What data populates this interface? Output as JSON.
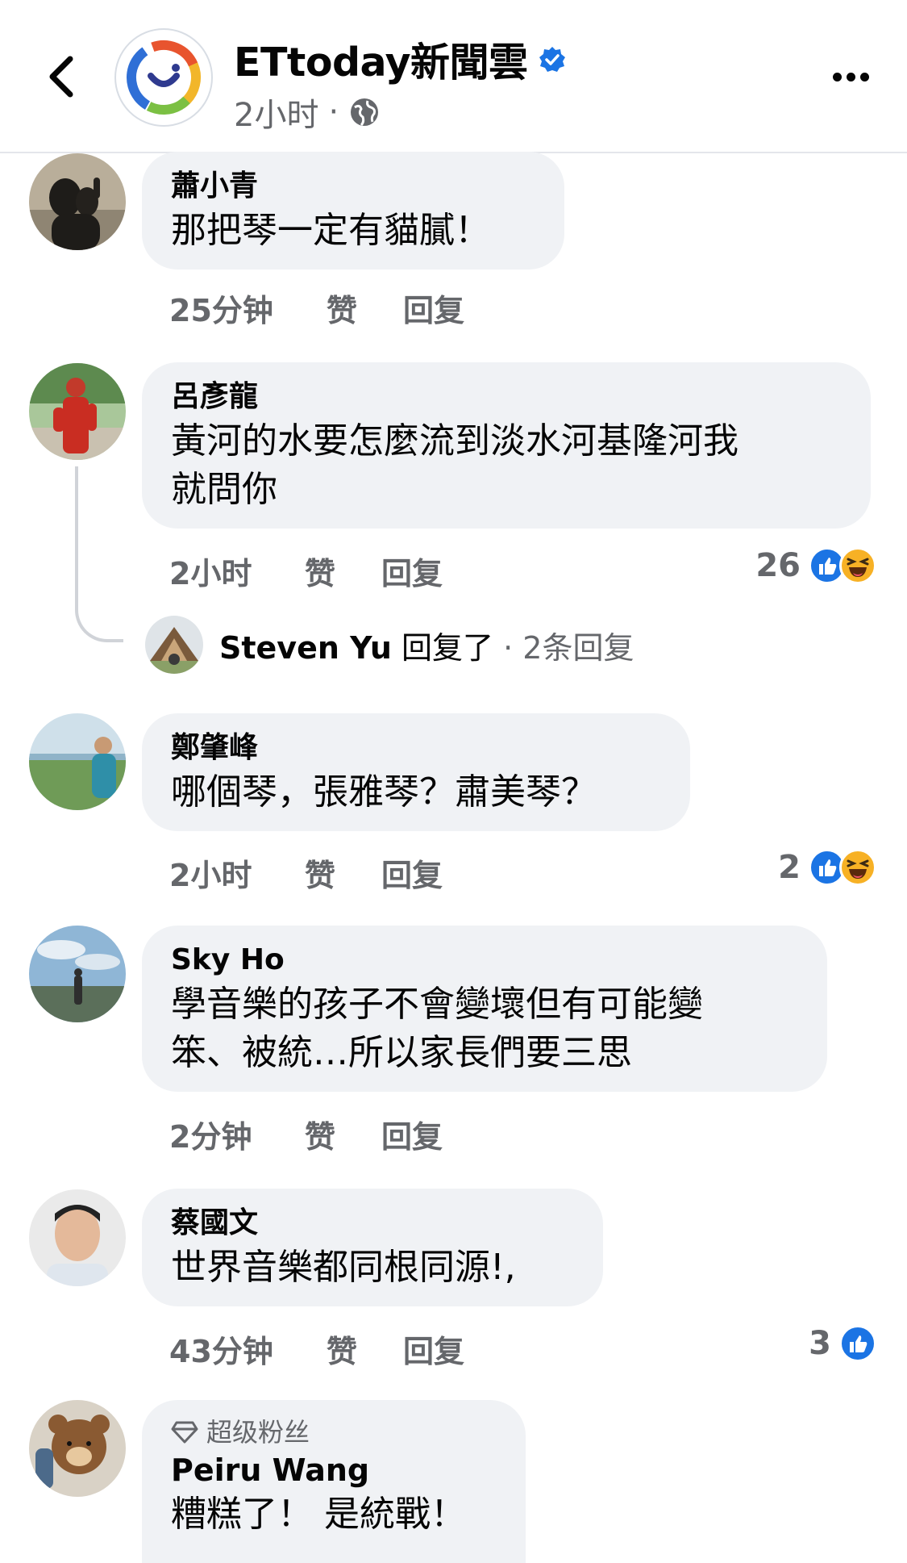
{
  "header": {
    "page_name": "ETtoday新聞雲",
    "time": "2小时",
    "separator": "·",
    "colors": {
      "verified": "#1b74e4",
      "logo_ring": [
        "#2f6fd6",
        "#f2b62a",
        "#e8542e",
        "#7bc043"
      ]
    }
  },
  "comments": [
    {
      "author": "蕭小青",
      "text": "那把琴一定有貓膩！",
      "time": "25分钟",
      "like_label": "赞",
      "reply_label": "回复"
    },
    {
      "author": "呂彥龍",
      "text_line1": "黃河的水要怎麼流到淡水河基隆河我",
      "text_line2": "就問你",
      "time": "2小时",
      "like_label": "赞",
      "reply_label": "回复",
      "reaction_count": "26",
      "reply_summary": {
        "name": "Steven Yu",
        "action": "回复了",
        "count": "· 2条回复"
      }
    },
    {
      "author": "鄭肇峰",
      "text": "哪個琴，張雅琴？肅美琴？",
      "time": "2小时",
      "like_label": "赞",
      "reply_label": "回复",
      "reaction_count": "2"
    },
    {
      "author": "Sky Ho",
      "text_line1": "學音樂的孩子不會變壞但有可能變",
      "text_line2": "笨、被統…所以家長們要三思",
      "time": "2分钟",
      "like_label": "赞",
      "reply_label": "回复"
    },
    {
      "author": "蔡國文",
      "text": "世界音樂都同根同源!,",
      "time": "43分钟",
      "like_label": "赞",
      "reply_label": "回复",
      "reaction_count": "3"
    },
    {
      "badge": "超级粉丝",
      "author": "Peiru Wang",
      "text": "糟糕了！ 是統戰！"
    }
  ]
}
